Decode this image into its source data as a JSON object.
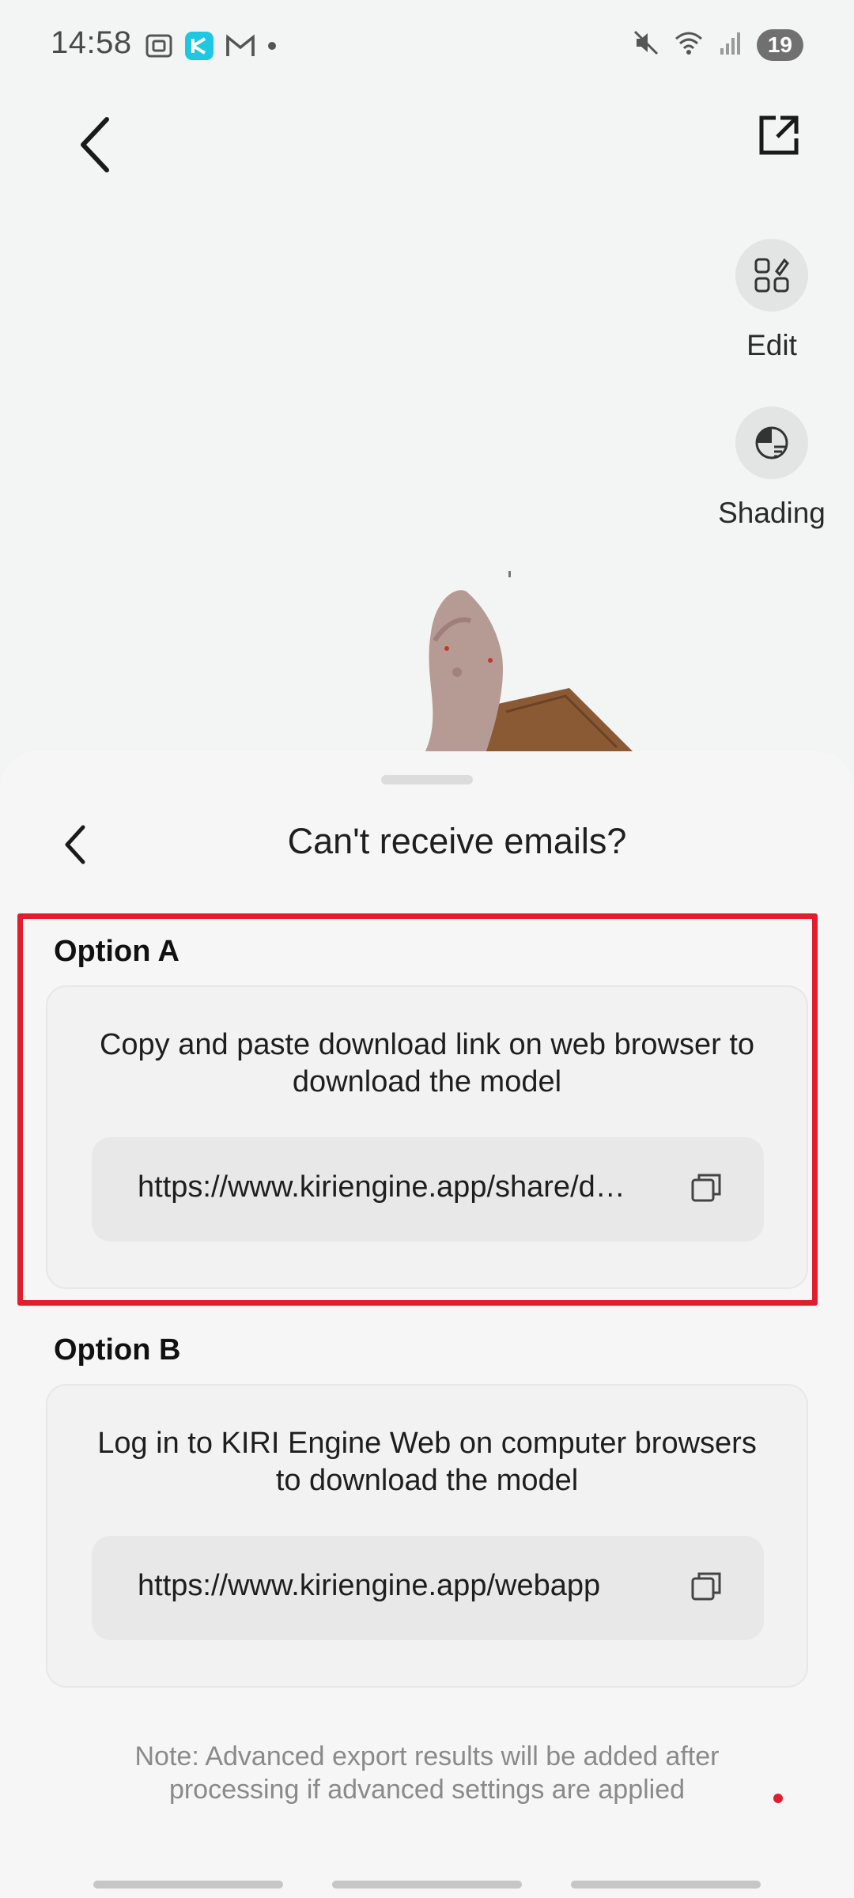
{
  "status_bar": {
    "time": "14:58",
    "battery": "19",
    "left_icons": [
      "screenshot-icon",
      "app-k-icon",
      "gmail-icon",
      "dot-icon"
    ],
    "right_icons": [
      "mute-icon",
      "wifi-icon",
      "signal-icon"
    ]
  },
  "top_bar": {
    "back_icon": "chevron-left-icon",
    "share_icon": "share-external-icon"
  },
  "side_tools": [
    {
      "label": "Edit",
      "icon": "grid-edit-icon"
    },
    {
      "label": "Shading",
      "icon": "shading-icon"
    }
  ],
  "sheet": {
    "title": "Can't receive emails?",
    "back_icon": "chevron-left-icon",
    "option_a": {
      "title": "Option A",
      "description": "Copy and paste download link on web browser to download the model",
      "link": "https://www.kiriengine.app/share/d…",
      "copy_icon": "copy-icon"
    },
    "option_b": {
      "title": "Option B",
      "description": "Log in to KIRI Engine Web on computer browsers to download the model",
      "link": "https://www.kiriengine.app/webapp",
      "copy_icon": "copy-icon"
    },
    "note": "Note: Advanced export results will be added after processing if advanced settings are applied"
  },
  "colors": {
    "highlight": "#e11d2e",
    "background": "#f3f4f4",
    "sheet": "#f6f6f6"
  }
}
